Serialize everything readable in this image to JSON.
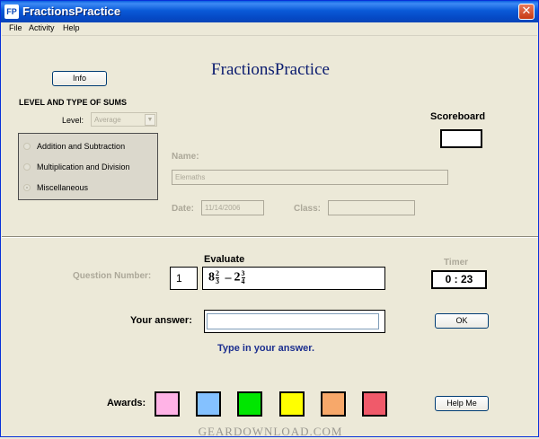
{
  "window": {
    "title": "FractionsPractice",
    "icon_text": "FP",
    "close_glyph": "✕"
  },
  "menu": {
    "items": [
      "File",
      "Activity",
      "Help"
    ]
  },
  "heading": "FractionsPractice",
  "info_button": "Info",
  "level_section": {
    "title": "LEVEL AND TYPE OF SUMS",
    "level_label": "Level:",
    "level_value": "Average",
    "options": [
      "Addition and Subtraction",
      "Multiplication and Division",
      "Miscellaneous"
    ],
    "selected_index": 2
  },
  "scoreboard": {
    "label": "Scoreboard",
    "value": ""
  },
  "student": {
    "name_label": "Name:",
    "name_value": "Elemaths",
    "date_label": "Date:",
    "date_value": "11/14/2006",
    "class_label": "Class:",
    "class_value": ""
  },
  "question": {
    "number_label": "Question Number:",
    "number_value": "1",
    "evaluate_label": "Evaluate",
    "expression": {
      "a_whole": "8",
      "a_num": "2",
      "a_den": "3",
      "operator": "–",
      "b_whole": "2",
      "b_num": "3",
      "b_den": "4"
    }
  },
  "timer": {
    "label": "Timer",
    "value": "0 : 23"
  },
  "answer": {
    "label": "Your answer:",
    "value": "",
    "hint": "Type in your answer.",
    "ok_button": "OK"
  },
  "awards": {
    "label": "Awards:",
    "colors": [
      "#ffb3e6",
      "#84c1ff",
      "#00e600",
      "#ffff00",
      "#f7a86a",
      "#f05a6a"
    ]
  },
  "help_button": "Help Me",
  "watermark": "GEARDOWNLOAD.COM",
  "colors": {
    "heading": "#0b1c6f",
    "hint": "#1c2f8f"
  }
}
